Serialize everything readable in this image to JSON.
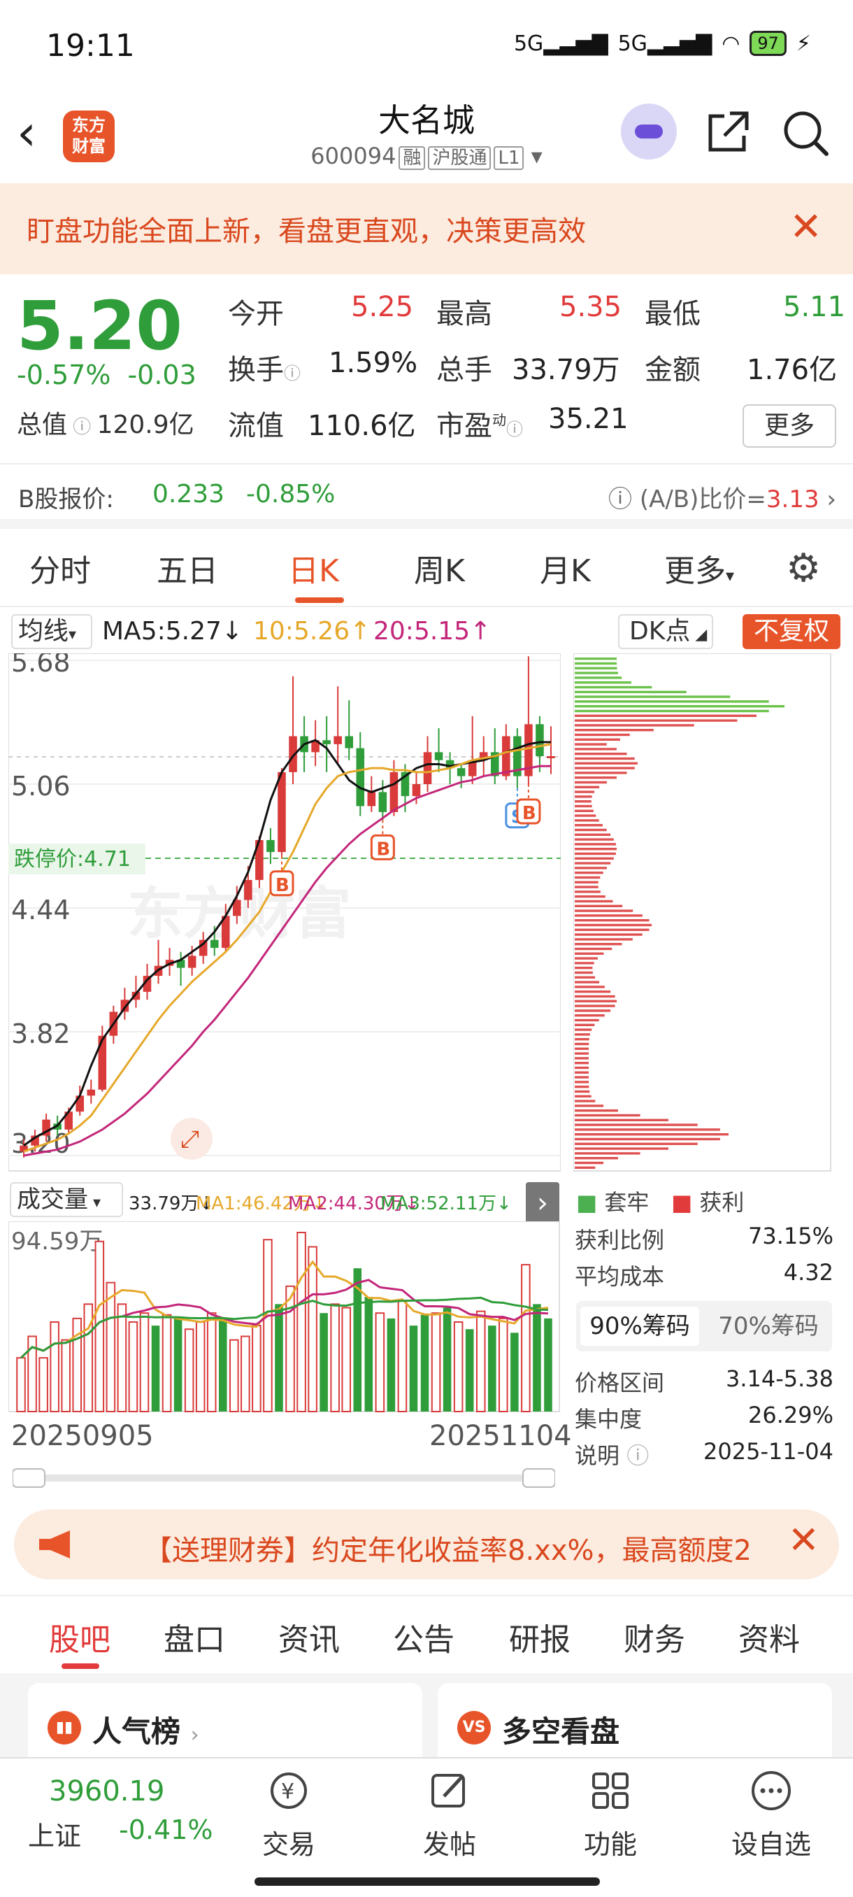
{
  "status_bar": {
    "time": "19:11",
    "network": "5G 5G",
    "battery": "97"
  },
  "header": {
    "stock_name": "大名城",
    "stock_code": "600094",
    "tags": [
      "融",
      "沪股通",
      "L1"
    ],
    "logo_text": [
      "东方",
      "财富"
    ]
  },
  "banner": {
    "text": "盯盘功能全面上新，看盘更直观，决策更高效"
  },
  "quote": {
    "price": "5.20",
    "change_pct": "-0.57%",
    "change_amt": "-0.03",
    "total_cap_label": "总值",
    "total_cap": "120.9亿",
    "open_label": "今开",
    "open": "5.25",
    "high_label": "最高",
    "high": "5.35",
    "low_label": "最低",
    "low": "5.11",
    "turnover_label": "换手",
    "turnover": "1.59%",
    "volume_label": "总手",
    "volume": "33.79万",
    "amount_label": "金额",
    "amount": "1.76亿",
    "float_cap_label": "流值",
    "float_cap": "110.6亿",
    "pe_label": "市盈",
    "pe_sup": "动",
    "pe": "35.21",
    "more_label": "更多"
  },
  "b_share": {
    "label": "B股报价:",
    "price": "0.233",
    "change": "-0.85%",
    "ratio_label": "(A/B)比价=",
    "ratio": "3.13"
  },
  "k_tabs": [
    "分时",
    "五日",
    "日K",
    "周K",
    "月K",
    "更多"
  ],
  "ma_row": {
    "select_label": "均线",
    "ma5": "MA5:5.27↓",
    "ma10": "10:5.26↑",
    "ma20": "20:5.15↑",
    "dk_label": "DK点",
    "fq_label": "不复权"
  },
  "chart_labels": {
    "y_ticks": [
      "5.68",
      "5.06",
      "4.44",
      "3.82",
      "3.20"
    ],
    "limit_down": "跌停价:4.71",
    "watermark": "东方财富"
  },
  "chart_data": {
    "type": "candlestick",
    "y_range": [
      3.2,
      5.68
    ],
    "candles": [
      [
        3.22,
        3.25,
        3.19,
        3.28
      ],
      [
        3.25,
        3.3,
        3.22,
        3.33
      ],
      [
        3.3,
        3.38,
        3.27,
        3.41
      ],
      [
        3.36,
        3.33,
        3.3,
        3.4
      ],
      [
        3.33,
        3.42,
        3.31,
        3.44
      ],
      [
        3.42,
        3.5,
        3.4,
        3.55
      ],
      [
        3.5,
        3.53,
        3.46,
        3.58
      ],
      [
        3.53,
        3.8,
        3.52,
        3.85
      ],
      [
        3.8,
        3.92,
        3.76,
        3.95
      ],
      [
        3.92,
        3.98,
        3.88,
        4.04
      ],
      [
        3.98,
        4.02,
        3.94,
        4.1
      ],
      [
        4.02,
        4.1,
        3.98,
        4.16
      ],
      [
        4.1,
        4.15,
        4.06,
        4.28
      ],
      [
        4.15,
        4.18,
        4.1,
        4.24
      ],
      [
        4.18,
        4.14,
        4.05,
        4.22
      ],
      [
        4.14,
        4.2,
        4.1,
        4.25
      ],
      [
        4.2,
        4.28,
        4.16,
        4.32
      ],
      [
        4.28,
        4.24,
        4.2,
        4.35
      ],
      [
        4.24,
        4.4,
        4.22,
        4.46
      ],
      [
        4.4,
        4.48,
        4.36,
        4.55
      ],
      [
        4.48,
        4.58,
        4.44,
        4.65
      ],
      [
        4.58,
        4.78,
        4.54,
        4.8
      ],
      [
        4.78,
        4.72,
        4.66,
        4.84
      ],
      [
        4.72,
        5.12,
        4.7,
        5.14
      ],
      [
        5.12,
        5.3,
        5.06,
        5.6
      ],
      [
        5.3,
        5.22,
        5.12,
        5.4
      ],
      [
        5.22,
        5.28,
        5.15,
        5.38
      ],
      [
        5.28,
        5.26,
        5.12,
        5.4
      ],
      [
        5.26,
        5.3,
        5.16,
        5.55
      ],
      [
        5.3,
        5.24,
        5.18,
        5.48
      ],
      [
        5.24,
        4.95,
        4.9,
        5.32
      ],
      [
        4.95,
        5.02,
        4.92,
        5.1
      ],
      [
        5.02,
        4.92,
        4.88,
        5.08
      ],
      [
        4.92,
        5.12,
        4.9,
        5.18
      ],
      [
        5.12,
        5.0,
        4.92,
        5.16
      ],
      [
        5.0,
        5.06,
        4.96,
        5.12
      ],
      [
        5.06,
        5.22,
        5.02,
        5.3
      ],
      [
        5.22,
        5.18,
        5.12,
        5.34
      ],
      [
        5.18,
        5.14,
        5.06,
        5.22
      ],
      [
        5.14,
        5.1,
        5.04,
        5.16
      ],
      [
        5.1,
        5.18,
        5.06,
        5.4
      ],
      [
        5.18,
        5.22,
        5.1,
        5.3
      ],
      [
        5.22,
        5.1,
        5.06,
        5.34
      ],
      [
        5.1,
        5.3,
        5.08,
        5.36
      ],
      [
        5.3,
        5.1,
        5.04,
        5.34
      ],
      [
        5.1,
        5.36,
        5.06,
        5.7
      ],
      [
        5.36,
        5.2,
        5.12,
        5.4
      ],
      [
        5.2,
        5.2,
        5.11,
        5.35
      ]
    ],
    "ma5": [
      3.25,
      3.29,
      3.32,
      3.35,
      3.42,
      3.5,
      3.65,
      3.78,
      3.86,
      3.94,
      4.01,
      4.08,
      4.13,
      4.16,
      4.18,
      4.22,
      4.26,
      4.32,
      4.4,
      4.5,
      4.62,
      4.78,
      4.98,
      5.12,
      5.2,
      5.26,
      5.28,
      5.24,
      5.16,
      5.08,
      5.04,
      5.02,
      5.04,
      5.06,
      5.1,
      5.14,
      5.16,
      5.16,
      5.15,
      5.16,
      5.17,
      5.18,
      5.2,
      5.22,
      5.24,
      5.26,
      5.27,
      5.27
    ],
    "ma10": [
      3.22,
      3.24,
      3.26,
      3.28,
      3.31,
      3.35,
      3.4,
      3.48,
      3.56,
      3.64,
      3.72,
      3.8,
      3.88,
      3.95,
      4.01,
      4.07,
      4.12,
      4.17,
      4.22,
      4.28,
      4.35,
      4.42,
      4.52,
      4.62,
      4.72,
      4.84,
      4.96,
      5.04,
      5.1,
      5.12,
      5.13,
      5.14,
      5.14,
      5.13,
      5.13,
      5.12,
      5.12,
      5.13,
      5.14,
      5.16,
      5.18,
      5.19,
      5.2,
      5.22,
      5.23,
      5.24,
      5.25,
      5.26
    ],
    "ma20": [
      3.2,
      3.21,
      3.22,
      3.23,
      3.25,
      3.27,
      3.3,
      3.33,
      3.37,
      3.41,
      3.46,
      3.51,
      3.57,
      3.63,
      3.69,
      3.75,
      3.82,
      3.88,
      3.95,
      4.02,
      4.09,
      4.17,
      4.25,
      4.33,
      4.41,
      4.49,
      4.57,
      4.64,
      4.7,
      4.76,
      4.81,
      4.85,
      4.89,
      4.93,
      4.96,
      4.99,
      5.01,
      5.03,
      5.05,
      5.07,
      5.08,
      5.1,
      5.11,
      5.12,
      5.13,
      5.14,
      5.15,
      5.15
    ],
    "buy_sell_marks": [
      {
        "index": 23,
        "label": "B"
      },
      {
        "index": 32,
        "label": "B"
      },
      {
        "index": 44,
        "label": "S"
      },
      {
        "index": 45,
        "label": "B"
      }
    ]
  },
  "volume": {
    "select_label": "成交量",
    "vol": "33.79万↓",
    "ma1": "MA1:46.42万↓",
    "ma2": "MA2:44.30万↓",
    "ma3": "MA3:52.11万↓",
    "y_top": "94.59万",
    "date_start": "20250905",
    "date_end": "20251104"
  },
  "volume_data": {
    "values": [
      30,
      42,
      30,
      50,
      40,
      52,
      60,
      95,
      72,
      60,
      50,
      55,
      48,
      54,
      52,
      46,
      50,
      55,
      52,
      40,
      42,
      48,
      96,
      60,
      70,
      100,
      92,
      55,
      60,
      58,
      80,
      64,
      55,
      52,
      62,
      48,
      54,
      55,
      58,
      50,
      46,
      56,
      48,
      52,
      44,
      82,
      60,
      52
    ],
    "red": [
      true,
      true,
      true,
      true,
      true,
      true,
      true,
      true,
      true,
      true,
      true,
      true,
      false,
      true,
      false,
      true,
      true,
      true,
      false,
      true,
      true,
      true,
      true,
      false,
      true,
      true,
      true,
      false,
      true,
      true,
      false,
      false,
      true,
      false,
      true,
      false,
      false,
      true,
      false,
      true,
      false,
      true,
      false,
      true,
      false,
      true,
      false,
      false
    ]
  },
  "chip": {
    "label_trapped": "套牢",
    "label_profit": "获利",
    "profit_ratio_label": "获利比例",
    "profit_ratio": "73.15%",
    "avg_cost_label": "平均成本",
    "avg_cost": "4.32",
    "tab_90": "90%筹码",
    "tab_70": "70%筹码",
    "range_label": "价格区间",
    "range": "3.14-5.38",
    "concentration_label": "集中度",
    "concentration": "26.29%",
    "note_label": "说明",
    "date": "2025-11-04"
  },
  "promo": {
    "text": "【送理财券】约定年化收益率8.xx%，最高额度2"
  },
  "bottom_tabs": [
    "股吧",
    "盘口",
    "资讯",
    "公告",
    "研报",
    "财务",
    "资料"
  ],
  "cards": {
    "left_title": "人气榜",
    "right_title": "多空看盘"
  },
  "bottom_nav": {
    "index_value": "3960.19",
    "index_name": "上证",
    "index_change": "-0.41%",
    "items": [
      "交易",
      "发帖",
      "功能",
      "设自选"
    ]
  }
}
